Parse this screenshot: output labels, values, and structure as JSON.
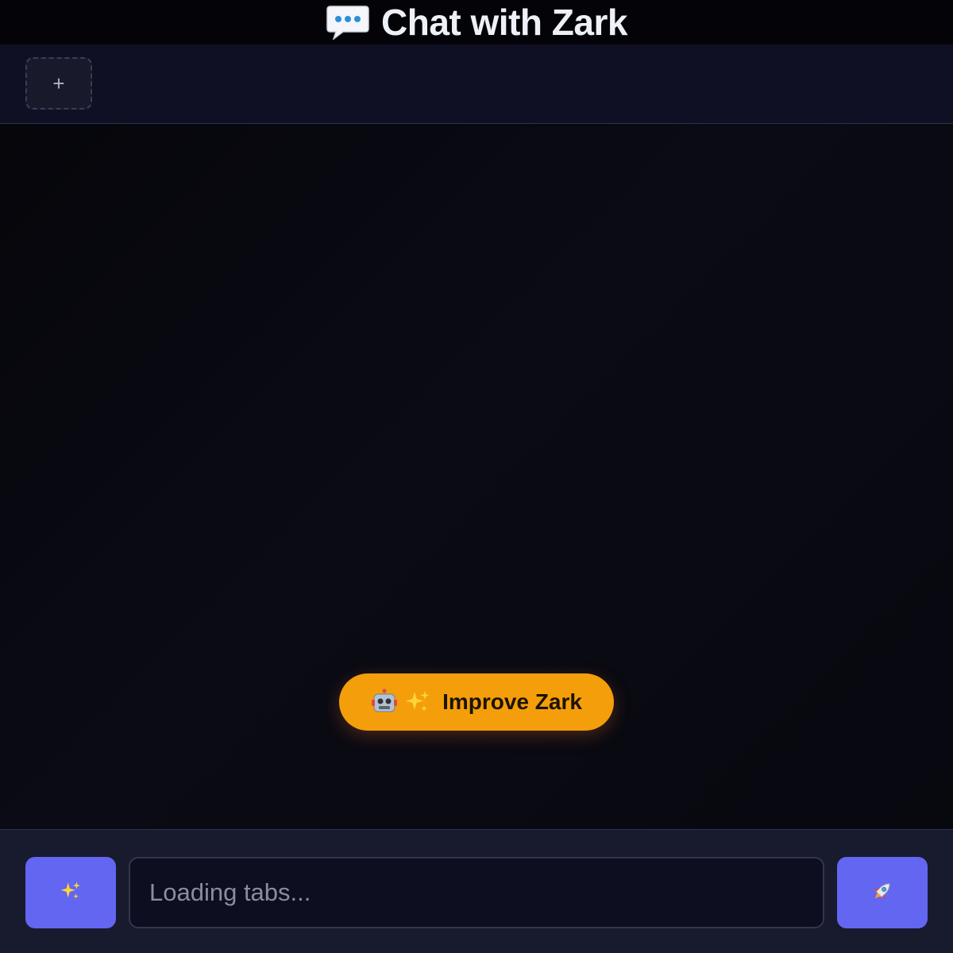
{
  "header": {
    "icon": "speech-balloon-icon",
    "title": "Chat with Zark"
  },
  "tabbar": {
    "add_tab_label": "+"
  },
  "improve_button": {
    "icons": [
      "robot-icon",
      "sparkles-icon"
    ],
    "label": "Improve Zark",
    "color": "#f59e0b"
  },
  "input_bar": {
    "magic_button_icon": "sparkles-icon",
    "input_placeholder": "Loading tabs...",
    "input_value": "",
    "send_button_icon": "rocket-icon",
    "button_color": "#6366f1"
  }
}
